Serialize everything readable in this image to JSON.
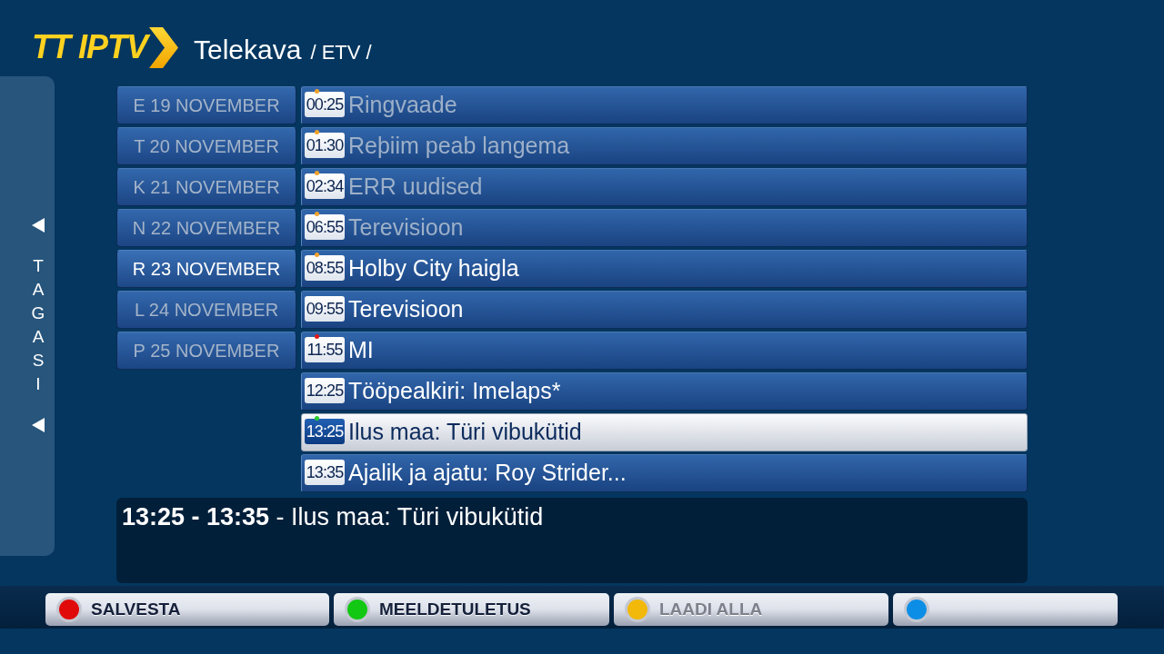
{
  "header": {
    "logo": "TT IPTV",
    "title": "Telekava",
    "breadcrumb": "/ ETV /"
  },
  "sidebar": {
    "back_label": "TAGASI"
  },
  "days": [
    {
      "label": "E 19 NOVEMBER",
      "selected": false
    },
    {
      "label": "T 20 NOVEMBER",
      "selected": false
    },
    {
      "label": "K 21 NOVEMBER",
      "selected": false
    },
    {
      "label": "N 22 NOVEMBER",
      "selected": false
    },
    {
      "label": "R 23 NOVEMBER",
      "selected": true
    },
    {
      "label": "L 24 NOVEMBER",
      "selected": false
    },
    {
      "label": "P 25 NOVEMBER",
      "selected": false
    }
  ],
  "programs": [
    {
      "time": "00:25",
      "title": "Ringvaade",
      "past": true,
      "selected": false,
      "color": "#f0a22a"
    },
    {
      "time": "01:30",
      "title": "Reþiim peab langema",
      "past": true,
      "selected": false,
      "color": "#f0a22a"
    },
    {
      "time": "02:34",
      "title": "ERR uudised",
      "past": true,
      "selected": false,
      "color": "#f0a22a"
    },
    {
      "time": "06:55",
      "title": "Terevisioon",
      "past": true,
      "selected": false,
      "color": "#f0a22a"
    },
    {
      "time": "08:55",
      "title": "Holby City haigla",
      "past": false,
      "selected": false,
      "color": "#f0a22a"
    },
    {
      "time": "09:55",
      "title": "Terevisioon",
      "past": false,
      "selected": false
    },
    {
      "time": "11:55",
      "title": "MI",
      "past": false,
      "selected": false,
      "color": "#e01818"
    },
    {
      "time": "12:25",
      "title": "Tööpealkiri: Imelaps*",
      "past": false,
      "selected": false
    },
    {
      "time": "13:25",
      "title": "Ilus maa: Türi vibukütid",
      "past": false,
      "selected": true,
      "color": "#2ecc2e"
    },
    {
      "time": "13:35",
      "title": "Ajalik ja ajatu: Roy Strider...",
      "past": false,
      "selected": false
    }
  ],
  "info": "**13:25 - 13:35** - Ilus maa: Türi vibukütid",
  "buttons": [
    {
      "label": "SALVESTA",
      "color": "#e00a0a",
      "disabled": false
    },
    {
      "label": "MEELDETULETUS",
      "color": "#12c812",
      "disabled": false
    },
    {
      "label": "LAADI ALLA",
      "color": "#f2b80a",
      "disabled": true
    },
    {
      "color": "#0c8ee6"
    }
  ]
}
